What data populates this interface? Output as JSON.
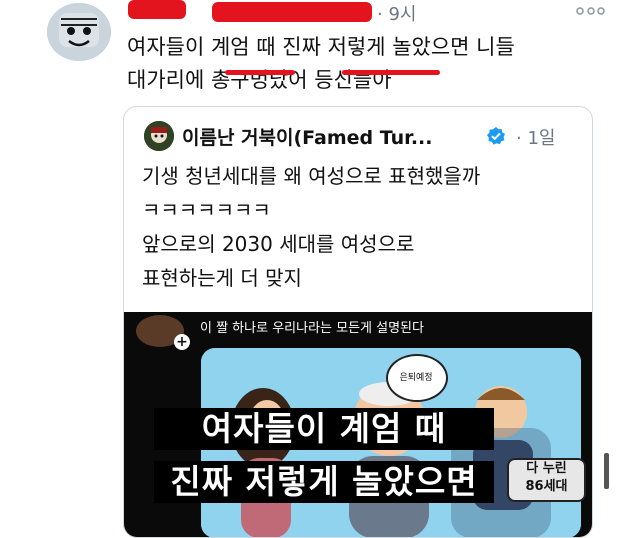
{
  "tweet": {
    "author_name": "",
    "time": "· 9시",
    "text_line1": "여자들이 계엄 때 진짜 저렇게 놀았으면 니들",
    "text_line2": "대가리에 총구멍났어 등신들아"
  },
  "quoted": {
    "author_name": "이름난 거북이(Famed Tur...",
    "time": "· 1일",
    "lines": [
      "기생 청년세대를 왜 여성으로 표현했을까",
      "ㅋㅋㅋㅋㅋㅋㅋ",
      "앞으로의 2030 세대를 여성으로",
      "표현하는게 더 맞지"
    ],
    "media": {
      "caption": "이 짤 하나로 우리나라는 모든게 설명된다",
      "overlay_line1": "여자들이 계엄 때",
      "overlay_line2": "진짜 저렇게 놀았으면",
      "tag_line1": "다 누린",
      "tag_line2": "86세대",
      "bubble_text": "은퇴예정"
    }
  },
  "colors": {
    "redaction": "#e3141d",
    "verified": "#1d9bf0",
    "muted": "#6b7884"
  }
}
